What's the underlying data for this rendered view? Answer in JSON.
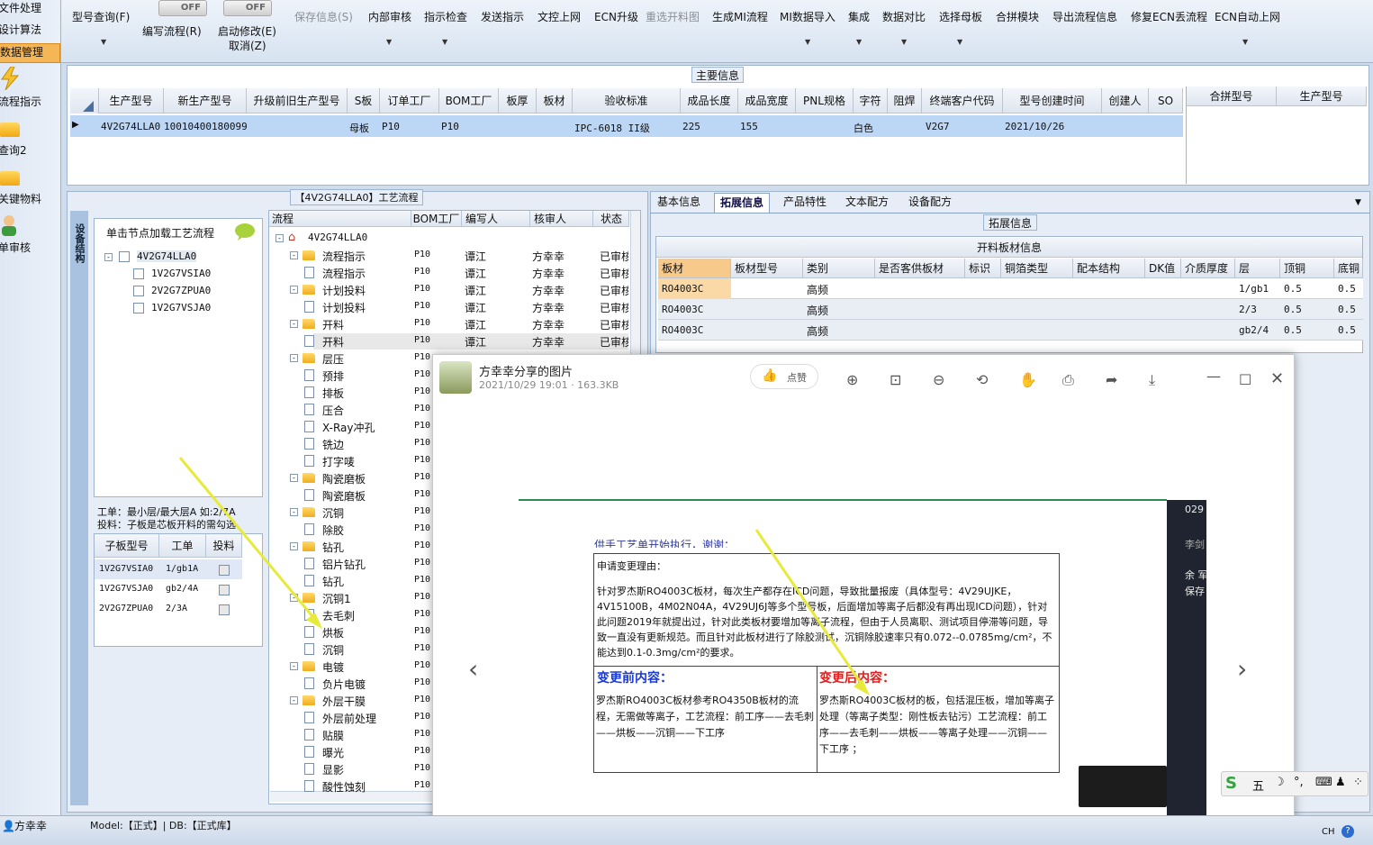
{
  "left_nav": {
    "items": [
      {
        "label": "文件处理"
      },
      {
        "label": "设计算法"
      },
      {
        "label": "数据管理"
      },
      {
        "label": "流程指示"
      },
      {
        "label": "查询2"
      },
      {
        "label": "关键物料"
      },
      {
        "label": "单审核"
      }
    ]
  },
  "toolbar": {
    "model_query": "型号查询(F)",
    "toggle1_state": "OFF",
    "toggle2_state": "OFF",
    "edit_flow": "编写流程(R)",
    "start_modify": "启动修改(E)",
    "cancel": "取消(Z)",
    "save_info": "保存信息(S)",
    "internal_review": "内部审核",
    "instruction_check": "指示检查",
    "send_instruction": "发送指示",
    "doc_release": "文控上网",
    "ecn_upgrade": "ECN升级",
    "reselect_cut": "重选开料图",
    "gen_mi_flow": "生成MI流程",
    "mi_import": "MI数据导入",
    "integration": "集成",
    "data_compare": "数据对比",
    "select_mother": "选择母板",
    "merge_module": "合拼模块",
    "export_flow": "导出流程信息",
    "repair_ecn": "修复ECN丢流程",
    "ecn_auto": "ECN自动上网"
  },
  "main_info": {
    "caption": "主要信息",
    "columns": [
      "生产型号",
      "新生产型号",
      "升级前旧生产型号",
      "S板",
      "订单工厂",
      "BOM工厂",
      "板厚",
      "板材",
      "验收标准",
      "成品长度",
      "成品宽度",
      "PNL规格",
      "字符",
      "阻焊",
      "终端客户代码",
      "型号创建时间",
      "创建人",
      "SO"
    ],
    "row": {
      "prod_model": "4V2G74LLA0",
      "new_model": "10010400180099",
      "s_board": "母板",
      "order_factory": "P10",
      "bom_factory": "P10",
      "standard": "IPC-6018 II级",
      "length": "225",
      "width": "155",
      "char": "白色",
      "customer": "V2G7",
      "created": "2021/10/26"
    },
    "merge_cols": [
      "合拼型号",
      "生产型号"
    ]
  },
  "process": {
    "caption": "【4V2G74LLA0】工艺流程",
    "side_tab": "设备结构",
    "load_hint": "单击节点加载工艺流程",
    "nodes": [
      "4V2G74LLA0",
      "1V2G7VSIA0",
      "2V2G7ZPUA0",
      "1V2G7VSJA0"
    ],
    "info_line1": "工单：最小层/最大层A  如:2/7A",
    "info_line2": "投料：子板是芯板开料的需勾选",
    "sub_columns": [
      "子板型号",
      "工单",
      "投料"
    ],
    "sub_rows": [
      {
        "model": "1V2G7VSIA0",
        "order": "1/gb1A"
      },
      {
        "model": "1V2G7VSJA0",
        "order": "gb2/4A"
      },
      {
        "model": "2V2G7ZPUA0",
        "order": "2/3A"
      }
    ],
    "tree_columns": [
      "流程",
      "BOM工厂",
      "编写人",
      "核审人",
      "状态"
    ],
    "tree": [
      {
        "label": "4V2G74LLA0",
        "level": 0,
        "kind": "root"
      },
      {
        "label": "流程指示",
        "level": 1,
        "kind": "folder",
        "bom": "P10",
        "writer": "谭江",
        "reviewer": "方幸幸",
        "status": "已审核"
      },
      {
        "label": "流程指示",
        "level": 2,
        "kind": "doc",
        "bom": "P10",
        "writer": "谭江",
        "reviewer": "方幸幸",
        "status": "已审核"
      },
      {
        "label": "计划投料",
        "level": 1,
        "kind": "folder",
        "bom": "P10",
        "writer": "谭江",
        "reviewer": "方幸幸",
        "status": "已审核"
      },
      {
        "label": "计划投料",
        "level": 2,
        "kind": "doc",
        "bom": "P10",
        "writer": "谭江",
        "reviewer": "方幸幸",
        "status": "已审核"
      },
      {
        "label": "开料",
        "level": 1,
        "kind": "folder",
        "bom": "P10",
        "writer": "谭江",
        "reviewer": "方幸幸",
        "status": "已审核"
      },
      {
        "label": "开料",
        "level": 2,
        "kind": "doc",
        "bom": "P10",
        "writer": "谭江",
        "reviewer": "方幸幸",
        "status": "已审核"
      },
      {
        "label": "层压",
        "level": 1,
        "kind": "folder",
        "bom": "P10"
      },
      {
        "label": "预排",
        "level": 2,
        "kind": "doc",
        "bom": "P10"
      },
      {
        "label": "排板",
        "level": 2,
        "kind": "doc",
        "bom": "P10"
      },
      {
        "label": "压合",
        "level": 2,
        "kind": "doc",
        "bom": "P10"
      },
      {
        "label": "X-Ray冲孔",
        "level": 2,
        "kind": "doc",
        "bom": "P10"
      },
      {
        "label": "铣边",
        "level": 2,
        "kind": "doc",
        "bom": "P10"
      },
      {
        "label": "打字唛",
        "level": 2,
        "kind": "doc",
        "bom": "P10"
      },
      {
        "label": "陶瓷磨板",
        "level": 1,
        "kind": "folder",
        "bom": "P10"
      },
      {
        "label": "陶瓷磨板",
        "level": 2,
        "kind": "doc",
        "bom": "P10"
      },
      {
        "label": "沉铜",
        "level": 1,
        "kind": "folder",
        "bom": "P10"
      },
      {
        "label": "除胶",
        "level": 2,
        "kind": "doc",
        "bom": "P10"
      },
      {
        "label": "钻孔",
        "level": 1,
        "kind": "folder",
        "bom": "P10"
      },
      {
        "label": "铝片钻孔",
        "level": 2,
        "kind": "doc",
        "bom": "P10"
      },
      {
        "label": "钻孔",
        "level": 2,
        "kind": "doc",
        "bom": "P10"
      },
      {
        "label": "沉铜1",
        "level": 1,
        "kind": "folder",
        "bom": "P10"
      },
      {
        "label": "去毛刺",
        "level": 2,
        "kind": "doc",
        "bom": "P10"
      },
      {
        "label": "烘板",
        "level": 2,
        "kind": "doc",
        "bom": "P10"
      },
      {
        "label": "沉铜",
        "level": 2,
        "kind": "doc",
        "bom": "P10"
      },
      {
        "label": "电镀",
        "level": 1,
        "kind": "folder",
        "bom": "P10"
      },
      {
        "label": "负片电镀",
        "level": 2,
        "kind": "doc",
        "bom": "P10"
      },
      {
        "label": "外层干膜",
        "level": 1,
        "kind": "folder",
        "bom": "P10"
      },
      {
        "label": "外层前处理",
        "level": 2,
        "kind": "doc",
        "bom": "P10"
      },
      {
        "label": "贴膜",
        "level": 2,
        "kind": "doc",
        "bom": "P10"
      },
      {
        "label": "曝光",
        "level": 2,
        "kind": "doc",
        "bom": "P10"
      },
      {
        "label": "显影",
        "level": 2,
        "kind": "doc",
        "bom": "P10"
      },
      {
        "label": "酸性蚀刻",
        "level": 2,
        "kind": "doc",
        "bom": "P10"
      }
    ]
  },
  "right": {
    "tabs": [
      "基本信息",
      "拓展信息",
      "产品特性",
      "文本配方",
      "设备配方"
    ],
    "caption": "拓展信息",
    "section_title": "开料板材信息",
    "columns": [
      "板材",
      "板材型号",
      "类别",
      "是否客供板材",
      "标识",
      "铜箔类型",
      "配本结构",
      "DK值",
      "介质厚度",
      "层",
      "顶铜",
      "底铜"
    ],
    "rows": [
      {
        "material": "RO4003C",
        "type": "高频",
        "layer": "1/gb1",
        "top": "0.5",
        "bottom": "0.5"
      },
      {
        "material": "RO4003C",
        "type": "高频",
        "layer": "2/3",
        "top": "0.5",
        "bottom": "0.5"
      },
      {
        "material": "RO4003C",
        "type": "高频",
        "layer": "gb2/4",
        "top": "0.5",
        "bottom": "0.5"
      }
    ]
  },
  "viewer": {
    "title": "方幸幸分享的图片",
    "meta": "2021/10/29 19:01 · 163.3KB",
    "like": "点赞",
    "doc": {
      "header_cut": "供手工艺单开始执行，谢谢：",
      "reason_label": "申请变更理由：",
      "reason_text": "针对罗杰斯RO4003C板材，每次生产都存在ICD问题，导致批量报废（具体型号：4V29UJKE，4V15100B，4M02N04A，4V29UJ6J等多个型号板，后面增加等离子后都没有再出现ICD问题），针对此问题2019年就提出过，针对此类板材要增加等离子流程，但由于人员离职、测试项目停滞等问题，导致一直没有更新规范。而且针对此板材进行了除胶测试，沉铜除胶速率只有0.072--0.0785mg/cm²，不能达到0.1-0.3mg/cm²的要求。",
      "before_title": "变更前内容：",
      "before_text": "罗杰斯RO4003C板材参考RO4350B板材的流程，无需做等离子，工艺流程：前工序——去毛刺——烘板——沉铜——下工序",
      "after_title": "变更后内容：",
      "after_text": "罗杰斯RO4003C板材的板，包括混压板，增加等离子处理（等离子类型：刚性板去钻污）工艺流程：前工序——去毛刺——烘板——等离子处理——沉铜——下工序 ；",
      "side_date": "029",
      "side_name": "李剑",
      "side_lines": [
        "余 军",
        "保存"
      ]
    }
  },
  "status": {
    "user": "方幸幸",
    "model_db": "Model:【正式】| DB:【正式库】",
    "ime_label": "五",
    "lang": "CH"
  },
  "colors": {
    "selected_row": "#bcd6f5",
    "accent_orange": "#f4b657",
    "arrow": "#e8ea3a",
    "before_title": "#1a3ad6",
    "after_title": "#e0201e"
  }
}
